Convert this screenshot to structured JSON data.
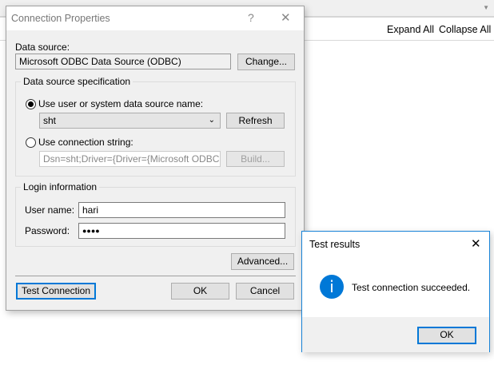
{
  "background": {
    "expand_all": "Expand All",
    "collapse_all": "Collapse All"
  },
  "connection_dialog": {
    "title": "Connection Properties",
    "help": "?",
    "close": "✕",
    "data_source_label": "Data source:",
    "data_source_value": "Microsoft ODBC Data Source (ODBC)",
    "change_label": "Change...",
    "spec_group": "Data source specification",
    "radio_dsn_label": "Use user or system data source name:",
    "dsn_value": "sht",
    "refresh_label": "Refresh",
    "radio_connstr_label": "Use connection string:",
    "connstr_value": "Dsn=sht;Driver={Driver={Microsoft ODBC for Or",
    "build_label": "Build...",
    "login_group": "Login information",
    "username_label": "User name:",
    "username_value": "hari",
    "password_label": "Password:",
    "password_value": "●●●●",
    "advanced_label": "Advanced...",
    "test_label": "Test Connection",
    "ok_label": "OK",
    "cancel_label": "Cancel"
  },
  "test_results": {
    "title": "Test results",
    "close": "✕",
    "icon": "i",
    "message": "Test connection succeeded.",
    "ok_label": "OK",
    "accent": "#0078d7"
  }
}
